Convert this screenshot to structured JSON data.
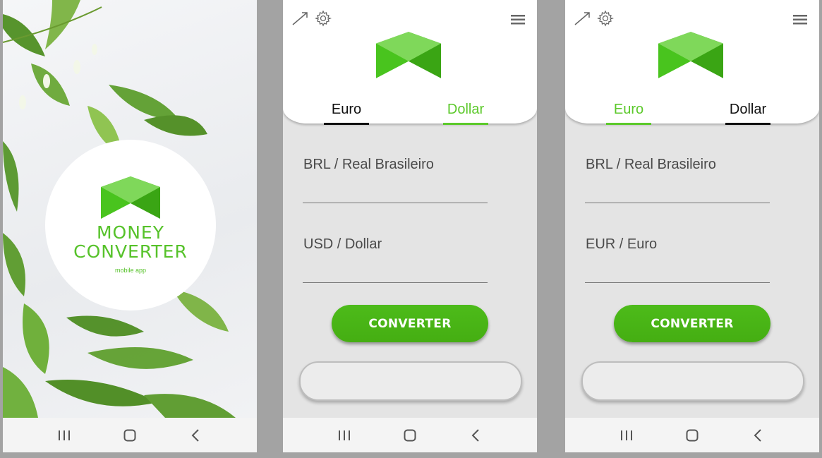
{
  "splash": {
    "title_line1": "MONEY",
    "title_line2": "CONVERTER",
    "subtitle": "mobile app"
  },
  "screens": [
    {
      "tabs": [
        {
          "label": "Euro",
          "active": false
        },
        {
          "label": "Dollar",
          "active": true
        }
      ],
      "field1_label": "BRL / Real Brasileiro",
      "field1_value": "",
      "field2_label": "USD / Dollar",
      "field2_value": "",
      "convert_label": "CONVERTER",
      "result": ""
    },
    {
      "tabs": [
        {
          "label": "Euro",
          "active": true
        },
        {
          "label": "Dollar",
          "active": false
        }
      ],
      "field1_label": "BRL / Real Brasileiro",
      "field1_value": "",
      "field2_label": "EUR / Euro",
      "field2_value": "",
      "convert_label": "CONVERTER",
      "result": ""
    }
  ],
  "icons": {
    "trend": "trend-arrow-icon",
    "settings": "gear-icon",
    "menu": "hamburger-menu-icon",
    "nav_recent": "recent-apps-icon",
    "nav_home": "home-icon",
    "nav_back": "back-icon"
  },
  "colors": {
    "accent": "#5cc92b",
    "button": "#45ae12",
    "screen_bg": "#e4e4e4"
  }
}
